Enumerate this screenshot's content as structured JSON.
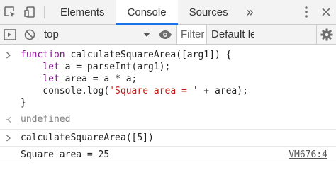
{
  "tabs": {
    "items": [
      {
        "label": "Elements",
        "active": false
      },
      {
        "label": "Console",
        "active": true
      },
      {
        "label": "Sources",
        "active": false
      }
    ],
    "more": "»"
  },
  "toolbar": {
    "context": "top",
    "filter_placeholder": "Filter",
    "levels": "Default leve"
  },
  "console": {
    "input_lines": [
      [
        {
          "t": "function",
          "k": "kw"
        },
        {
          "t": " calculateSquareArea([arg1]) {",
          "k": ""
        }
      ],
      [
        {
          "t": "    ",
          "k": ""
        },
        {
          "t": "let",
          "k": "kw"
        },
        {
          "t": " a = parseInt(arg1);",
          "k": ""
        }
      ],
      [
        {
          "t": "    ",
          "k": ""
        },
        {
          "t": "let",
          "k": "kw"
        },
        {
          "t": " area = a * a;",
          "k": ""
        }
      ],
      [
        {
          "t": "    console.log(",
          "k": ""
        },
        {
          "t": "'Square area = '",
          "k": "str"
        },
        {
          "t": " + area);",
          "k": ""
        }
      ],
      [
        {
          "t": "}",
          "k": ""
        }
      ]
    ],
    "result": "undefined",
    "second_input": "calculateSquareArea([5])",
    "log_output": "Square area = 25",
    "log_source": "VM676:4"
  },
  "colors": {
    "keyword": "#881391",
    "string": "#c41a16",
    "active_tab_underline": "#1a73e8"
  },
  "icons": [
    "inspect-icon",
    "device-toggle-icon",
    "more-vertical-icon",
    "close-icon",
    "sidebar-toggle-icon",
    "clear-console-icon",
    "eye-icon",
    "gear-icon",
    "prompt-chevron-icon",
    "result-arrow-icon"
  ]
}
